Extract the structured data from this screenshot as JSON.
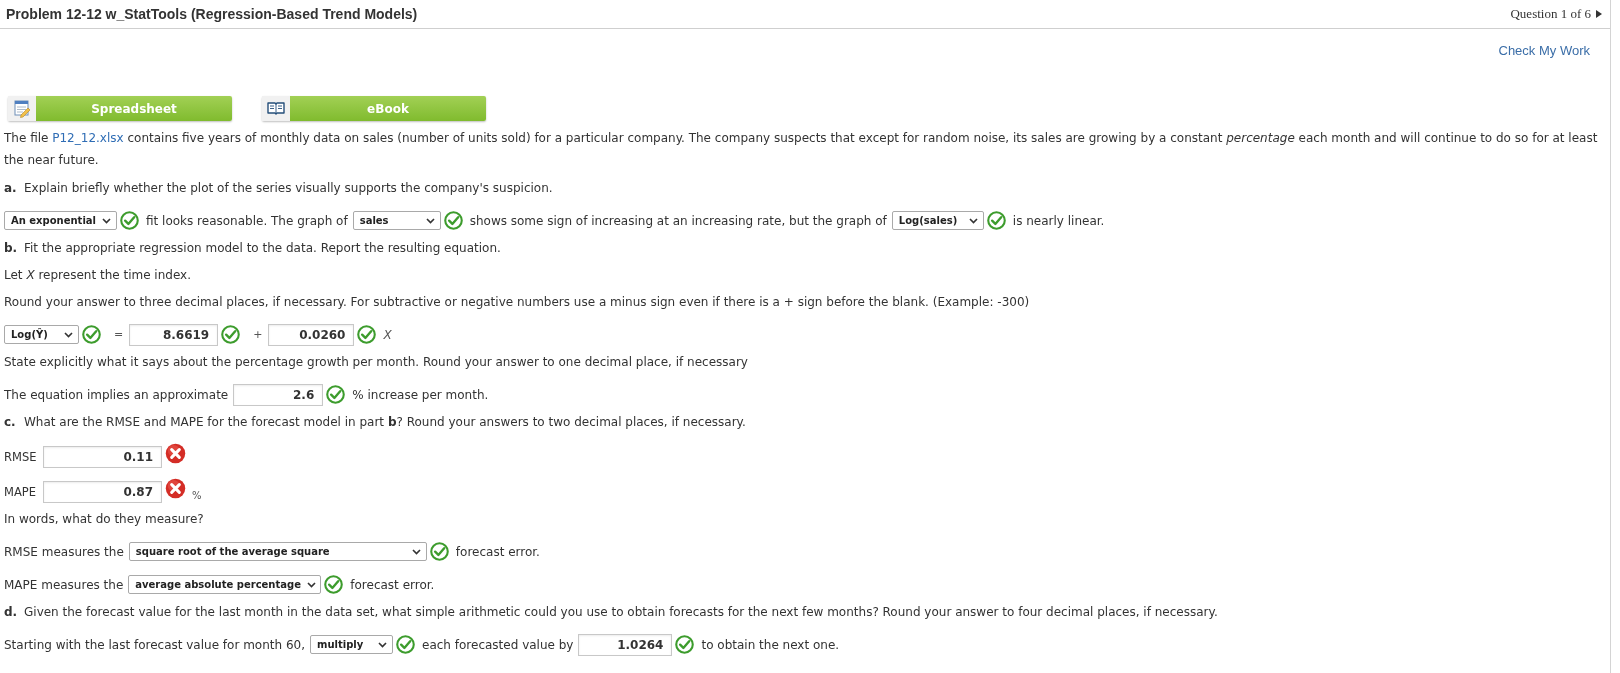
{
  "header": {
    "title": "Problem 12-12 w_StatTools (Regression-Based Trend Models)",
    "question_counter": "Question 1 of 6"
  },
  "check_my_work": "Check My Work",
  "resources": [
    {
      "kind": "spreadsheet",
      "label": "Spreadsheet"
    },
    {
      "kind": "ebook",
      "label": "eBook"
    }
  ],
  "intro": {
    "text_before": "The file ",
    "link": "P12_12.xlsx",
    "text_after": " contains five years of monthly data on sales (number of units sold) for a particular company. The company suspects that except for random noise, its sales are growing by a constant *percentage* each month and will continue to do so for at least the near future."
  },
  "questions": [
    {
      "kind": "prompt",
      "label": "a.",
      "text": "Explain briefly whether the plot of the series visually supports the company's suspicion."
    },
    {
      "kind": "answer",
      "items": [
        {
          "kind": "dropdown",
          "value": "An exponential",
          "correct": true
        },
        {
          "kind": "text",
          "text": "fit looks reasonable. The graph of"
        },
        {
          "kind": "dropdown",
          "value": "sales",
          "correct": true
        },
        {
          "kind": "text",
          "text": "shows some sign of increasing at an increasing rate, but the graph of"
        },
        {
          "kind": "dropdown",
          "value": "Log(sales)",
          "correct": true
        },
        {
          "kind": "text",
          "text": "is nearly linear."
        }
      ]
    },
    {
      "kind": "prompt",
      "label": "b.",
      "text": "Fit the appropriate regression model to the data. Report the resulting equation."
    },
    {
      "kind": "note",
      "text": "Let *X* represent the time index."
    },
    {
      "kind": "note",
      "text": "Round your answer to three decimal places, if necessary. For subtractive or negative numbers use a minus sign even if there is a + sign before the blank. (Example: -300)"
    },
    {
      "kind": "answer",
      "items": [
        {
          "kind": "dropdown",
          "value": "Log(Ŷ)",
          "correct": true
        },
        {
          "kind": "symbol",
          "text": "="
        },
        {
          "kind": "input",
          "value": "8.6619",
          "correct": true
        },
        {
          "kind": "symbol",
          "text": "+"
        },
        {
          "kind": "input",
          "value": "0.0260",
          "correct": true
        },
        {
          "kind": "variable",
          "text": "X"
        }
      ]
    },
    {
      "kind": "note",
      "text": "State explicitly what it says about the percentage growth per month. Round your answer to one decimal place, if necessary"
    },
    {
      "kind": "answer",
      "items": [
        {
          "kind": "text",
          "text": "The equation implies an approximate"
        },
        {
          "kind": "input",
          "value": "2.6",
          "correct": true
        },
        {
          "kind": "text",
          "text": "% increase per month."
        }
      ]
    },
    {
      "kind": "prompt",
      "label": "c.",
      "text": "What are the RMSE and MAPE for the forecast model in part **b**? Round your answers to two decimal places, if necessary."
    },
    {
      "kind": "answer",
      "items": [
        {
          "kind": "label",
          "text": "RMSE"
        },
        {
          "kind": "input",
          "value": "0.11",
          "correct": false
        }
      ]
    },
    {
      "kind": "answer",
      "items": [
        {
          "kind": "label",
          "text": "MAPE"
        },
        {
          "kind": "input",
          "value": "0.87",
          "correct": false
        },
        {
          "kind": "unit",
          "text": "%"
        }
      ]
    },
    {
      "kind": "note",
      "text": "In words, what do they measure?"
    },
    {
      "kind": "answer",
      "items": [
        {
          "kind": "text",
          "text": "RMSE measures the"
        },
        {
          "kind": "dropdown",
          "value": "square root of the average square",
          "correct": true
        },
        {
          "kind": "text",
          "text": "forecast error."
        }
      ]
    },
    {
      "kind": "answer",
      "items": [
        {
          "kind": "text",
          "text": "MAPE measures the"
        },
        {
          "kind": "dropdown",
          "value": "average absolute percentage",
          "correct": true
        },
        {
          "kind": "text",
          "text": "forecast error."
        }
      ]
    },
    {
      "kind": "prompt",
      "label": "d.",
      "text": "Given the forecast value for the last month in the data set, what simple arithmetic could you use to obtain forecasts for the next few months? Round your answer to four decimal places, if necessary."
    },
    {
      "kind": "answer",
      "items": [
        {
          "kind": "text",
          "text": "Starting with the last forecast value for month 60,"
        },
        {
          "kind": "dropdown",
          "value": "multiply",
          "correct": true
        },
        {
          "kind": "text",
          "text": "each forecasted value by"
        },
        {
          "kind": "input",
          "value": "1.0264",
          "correct": true
        },
        {
          "kind": "text",
          "text": "to obtain the next one."
        }
      ]
    }
  ]
}
